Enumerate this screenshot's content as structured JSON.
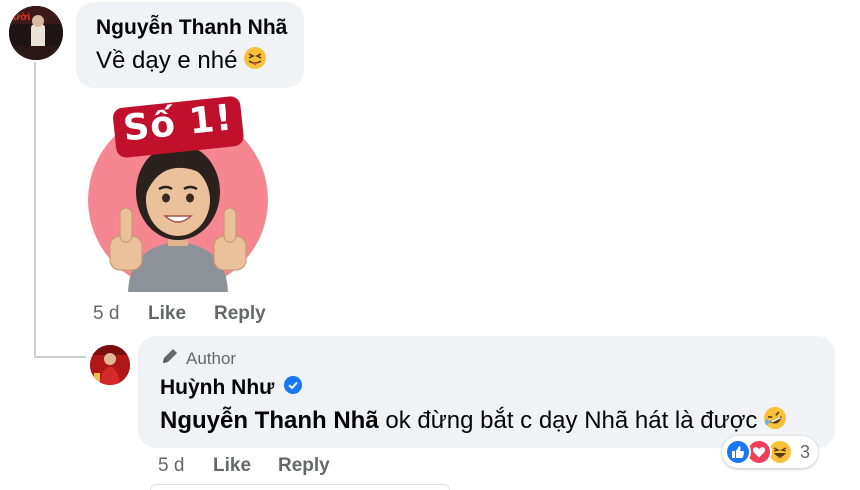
{
  "comment": {
    "author": "Nguyễn Thanh Nhã",
    "text": "Về dạy e nhé",
    "text_emoji": "squinting-tongue-emoji",
    "sticker_text": "Số 1!",
    "time": "5 d",
    "like_label": "Like",
    "reply_label": "Reply"
  },
  "reply": {
    "badge_label": "Author",
    "author": "Huỳnh Như",
    "verified": true,
    "mention": "Nguyễn Thanh Nhã",
    "text": "ok đừng bắt c dạy Nhã hát là được",
    "text_emoji": "rolling-laughing-emoji",
    "time": "5 d",
    "like_label": "Like",
    "reply_label": "Reply",
    "reactions": [
      "like",
      "love",
      "haha"
    ],
    "reaction_count": "3"
  },
  "colors": {
    "bubble": "#f0f2f5",
    "meta_text": "#65676b",
    "like_blue": "#1877f2",
    "love_red": "#f33e58",
    "sticker_pink": "#f6868f",
    "sticker_badge": "#c0102b"
  }
}
